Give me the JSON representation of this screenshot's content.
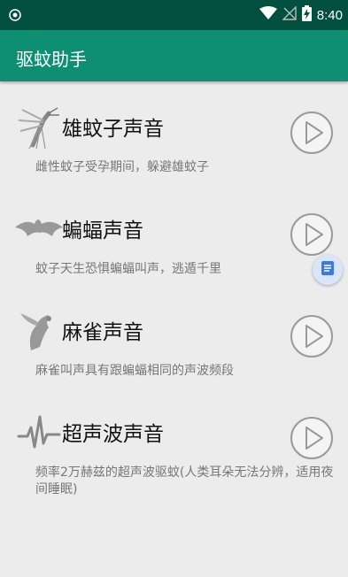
{
  "status_bar": {
    "time": "8:40",
    "icons": [
      "shield-icon",
      "wifi-icon",
      "no-signal-icon",
      "battery-charging-icon"
    ]
  },
  "app_bar": {
    "title": "驱蚊助手"
  },
  "sounds": [
    {
      "name": "雄蚊子声音",
      "desc": "雌性蚊子受孕期间，躲避雄蚊子",
      "icon": "mosquito-icon"
    },
    {
      "name": "蝙蝠声音",
      "desc": "蚊子天生恐惧蝙蝠叫声，逃遁千里",
      "icon": "bat-icon"
    },
    {
      "name": "麻雀声音",
      "desc": "麻雀叫声具有跟蝙蝠相同的声波频段",
      "icon": "sparrow-icon"
    },
    {
      "name": "超声波声音",
      "desc": "频率2万赫兹的超声波驱蚊(人类耳朵无法分辨，适用夜间睡眠)",
      "icon": "soundwave-icon"
    }
  ],
  "colors": {
    "status_bar": "#004f3f",
    "app_bar": "#0e8e72",
    "background": "#ececec"
  }
}
